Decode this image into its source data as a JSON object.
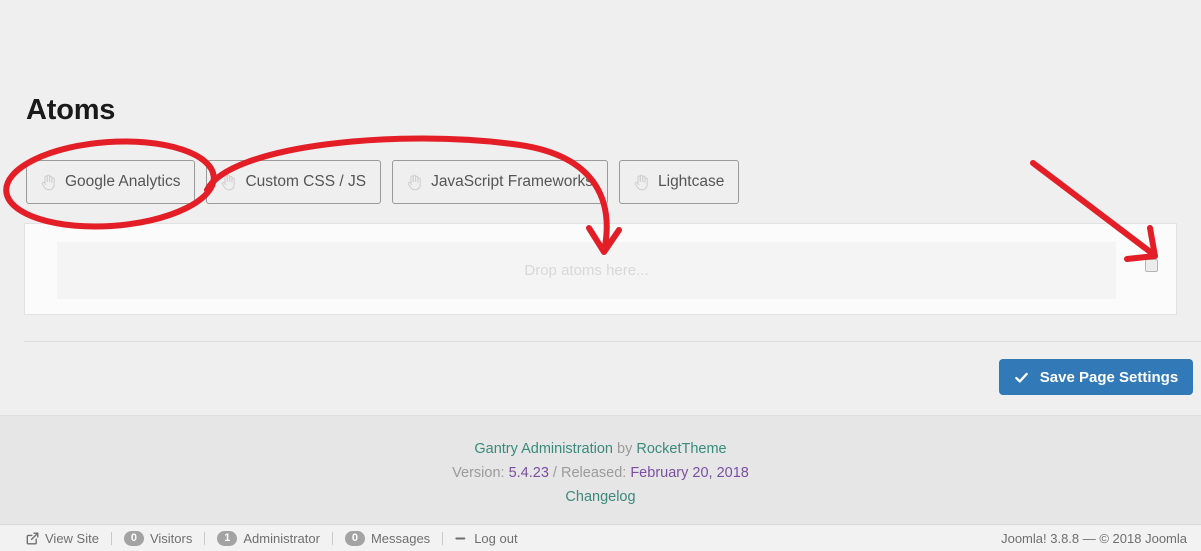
{
  "page": {
    "title": "Atoms"
  },
  "atoms_picker": {
    "items": [
      {
        "label": "Google Analytics",
        "icon": "hand-drag-icon"
      },
      {
        "label": "Custom CSS / JS",
        "icon": "hand-drag-icon"
      },
      {
        "label": "JavaScript Frameworks",
        "icon": "hand-drag-icon"
      },
      {
        "label": "Lightcase",
        "icon": "hand-drag-icon"
      }
    ]
  },
  "drop_zone": {
    "placeholder": "Drop atoms here..."
  },
  "actions": {
    "save_label": "Save Page Settings",
    "save_icon": "check-icon",
    "save_color": "#327ab7"
  },
  "footer": {
    "product_link": "Gantry Administration",
    "by_text": " by ",
    "vendor_link": "RocketTheme",
    "version_label": "Version: ",
    "version_value": "5.4.23",
    "separator": " / ",
    "released_label": "Released: ",
    "released_value": "February 20, 2018",
    "changelog_link": "Changelog",
    "link_color": "#3a8a7c",
    "version_color": "#7a4fa3"
  },
  "status_bar": {
    "items": [
      {
        "label": "View Site",
        "icon": "external-link-icon",
        "badge": null
      },
      {
        "label": "Visitors",
        "icon": null,
        "badge": "0"
      },
      {
        "label": "Administrator",
        "icon": null,
        "badge": "1"
      },
      {
        "label": "Messages",
        "icon": null,
        "badge": "0"
      },
      {
        "label": "Log out",
        "icon": "logout-icon",
        "badge": null
      }
    ],
    "right_text": "Joomla! 3.8.8  —  © 2018 Joomla"
  },
  "annotations": {
    "color": "#e41e26",
    "shapes": [
      {
        "type": "ellipse",
        "target": "google-analytics-chip"
      },
      {
        "type": "curved-arrow",
        "target": "drop-zone"
      },
      {
        "type": "straight-arrow",
        "target": "panel-toggle"
      }
    ]
  }
}
